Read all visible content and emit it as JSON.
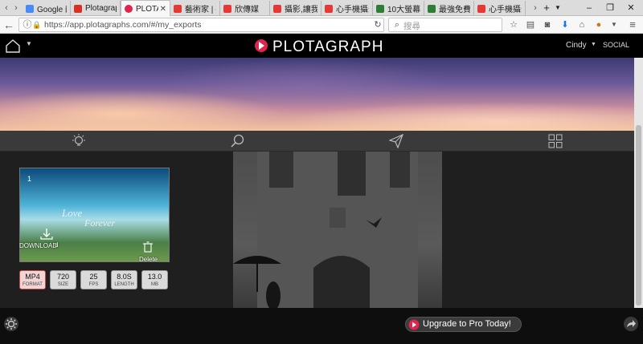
{
  "browser": {
    "tabs": [
      {
        "title": "Google 翻",
        "color": "#4a8af4"
      },
      {
        "title": "Plotagrapl",
        "color": "#d93025"
      },
      {
        "title": "PLOTA",
        "color": "#e0244d",
        "active": true
      },
      {
        "title": "藝術家 | 手",
        "color": "#e53935"
      },
      {
        "title": "欣傳媒",
        "color": "#e53935"
      },
      {
        "title": "攝影,讓我",
        "color": "#e53935"
      },
      {
        "title": "心手機攝影",
        "color": "#e53935"
      },
      {
        "title": "10大螢幕",
        "color": "#2e7d32"
      },
      {
        "title": "最強免費",
        "color": "#2e7d32"
      },
      {
        "title": "心手機攝影",
        "color": "#e53935"
      }
    ],
    "new_tab": "+",
    "url": "https://app.plotagraphs.com/#/my_exports",
    "search_placeholder": "搜尋"
  },
  "app": {
    "brand": "PLOTAGRAPH",
    "user": "Cindy",
    "social": "SOCIAL"
  },
  "export": {
    "index": "1",
    "download_label": "DOWNLOAD",
    "download_suffix": "d",
    "delete_label": "Delete",
    "specs": [
      {
        "value": "MP4",
        "label": "FORMAT"
      },
      {
        "value": "720",
        "label": "SIZE"
      },
      {
        "value": "25",
        "label": "FPS"
      },
      {
        "value": "8.0S",
        "label": "LENGTH"
      },
      {
        "value": "13.0",
        "label": "MB"
      }
    ]
  },
  "footer": {
    "upgrade_label": "Upgrade to Pro Today!"
  }
}
